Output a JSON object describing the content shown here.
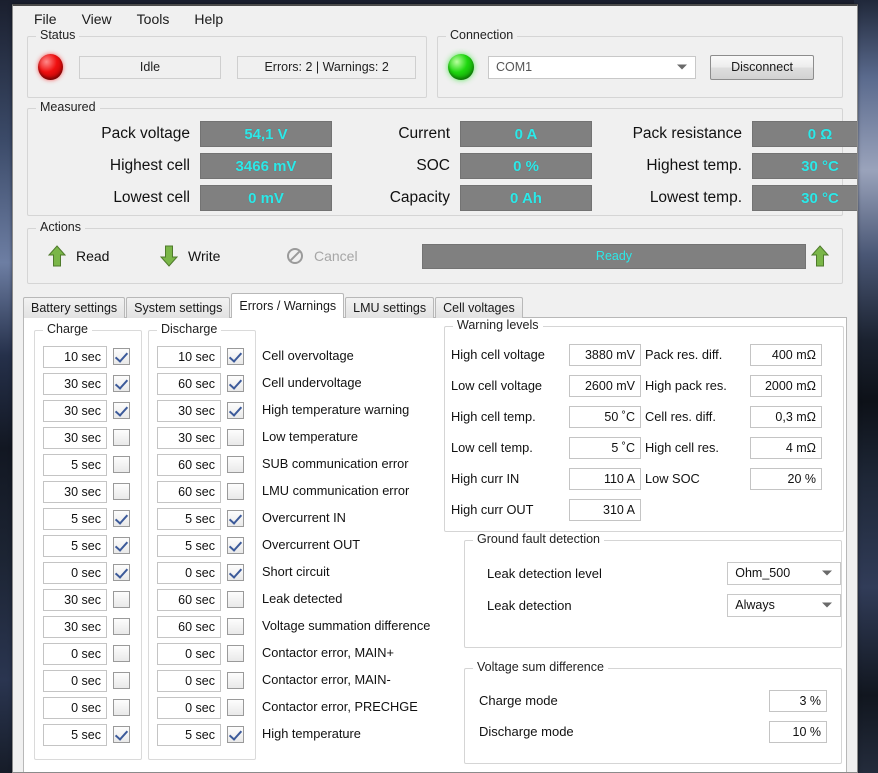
{
  "menu": {
    "items": [
      "File",
      "View",
      "Tools",
      "Help"
    ]
  },
  "status": {
    "legend": "Status",
    "led": "red-led-icon",
    "state": "Idle",
    "counts": "Errors: 2  |  Warnings: 2"
  },
  "connection": {
    "legend": "Connection",
    "led": "green-led-icon",
    "port": "COM1",
    "button": "Disconnect"
  },
  "measured": {
    "legend": "Measured",
    "rows": [
      {
        "l1": "Pack voltage",
        "v1": "54,1 V",
        "l2": "Current",
        "v2": "0 A",
        "l3": "Pack resistance",
        "v3": "0 Ω"
      },
      {
        "l1": "Highest cell",
        "v1": "3466 mV",
        "l2": "SOC",
        "v2": "0 %",
        "l3": "Highest temp.",
        "v3": "30 °C"
      },
      {
        "l1": "Lowest cell",
        "v1": "0 mV",
        "l2": "Capacity",
        "v2": "0 Ah",
        "l3": "Lowest temp.",
        "v3": "30 °C"
      }
    ]
  },
  "actions": {
    "legend": "Actions",
    "read": "Read",
    "write": "Write",
    "cancel": "Cancel",
    "progress": "Ready",
    "accent_green": "#7ab648",
    "accent_cyan": "#2ce8e8"
  },
  "tabs": [
    {
      "label": "Battery settings",
      "active": false
    },
    {
      "label": "System settings",
      "active": false
    },
    {
      "label": "Errors / Warnings",
      "active": true
    },
    {
      "label": "LMU settings",
      "active": false
    },
    {
      "label": "Cell voltages",
      "active": false
    }
  ],
  "charge": {
    "legend": "Charge",
    "values": [
      "10 sec",
      "30 sec",
      "30 sec",
      "30 sec",
      "5 sec",
      "30 sec",
      "5 sec",
      "5 sec",
      "0 sec",
      "30 sec",
      "30 sec",
      "0 sec",
      "0 sec",
      "0 sec",
      "5 sec"
    ],
    "checked": [
      true,
      true,
      true,
      false,
      false,
      false,
      true,
      true,
      true,
      false,
      false,
      false,
      false,
      false,
      true
    ]
  },
  "discharge": {
    "legend": "Discharge",
    "values": [
      "10 sec",
      "60 sec",
      "30 sec",
      "30 sec",
      "60 sec",
      "60 sec",
      "5 sec",
      "5 sec",
      "0 sec",
      "60 sec",
      "60 sec",
      "0 sec",
      "0 sec",
      "0 sec",
      "5 sec"
    ],
    "checked": [
      true,
      true,
      true,
      false,
      false,
      false,
      true,
      true,
      true,
      false,
      false,
      false,
      false,
      false,
      true
    ]
  },
  "error_labels": [
    "Cell overvoltage",
    "Cell undervoltage",
    "High temperature warning",
    "Low temperature",
    "SUB communication error",
    "LMU communication error",
    "Overcurrent IN",
    "Overcurrent OUT",
    "Short circuit",
    "Leak detected",
    "Voltage summation difference",
    "Contactor error, MAIN+",
    "Contactor error, MAIN-",
    "Contactor error, PRECHGE",
    "High temperature"
  ],
  "warning_levels": {
    "legend": "Warning levels",
    "left": [
      {
        "label": "High cell voltage",
        "value": "3880 mV"
      },
      {
        "label": "Low cell voltage",
        "value": "2600 mV"
      },
      {
        "label": "High cell temp.",
        "value": "50 ˚C"
      },
      {
        "label": "Low cell temp.",
        "value": "5 ˚C"
      },
      {
        "label": "High curr IN",
        "value": "110 A"
      },
      {
        "label": "High curr OUT",
        "value": "310 A"
      }
    ],
    "right": [
      {
        "label": "Pack res. diff.",
        "value": "400 mΩ"
      },
      {
        "label": "High pack res.",
        "value": "2000 mΩ"
      },
      {
        "label": "Cell res. diff.",
        "value": "0,3 mΩ"
      },
      {
        "label": "High cell res.",
        "value": "4 mΩ"
      },
      {
        "label": "Low SOC",
        "value": "20 %"
      }
    ]
  },
  "ground_fault": {
    "legend": "Ground fault detection",
    "rows": [
      {
        "label": "Leak detection level",
        "value": "Ohm_500"
      },
      {
        "label": "Leak detection",
        "value": "Always"
      }
    ]
  },
  "voltage_sum": {
    "legend": "Voltage sum difference",
    "rows": [
      {
        "label": "Charge mode",
        "value": "3 %"
      },
      {
        "label": "Discharge mode",
        "value": "10 %"
      }
    ]
  }
}
